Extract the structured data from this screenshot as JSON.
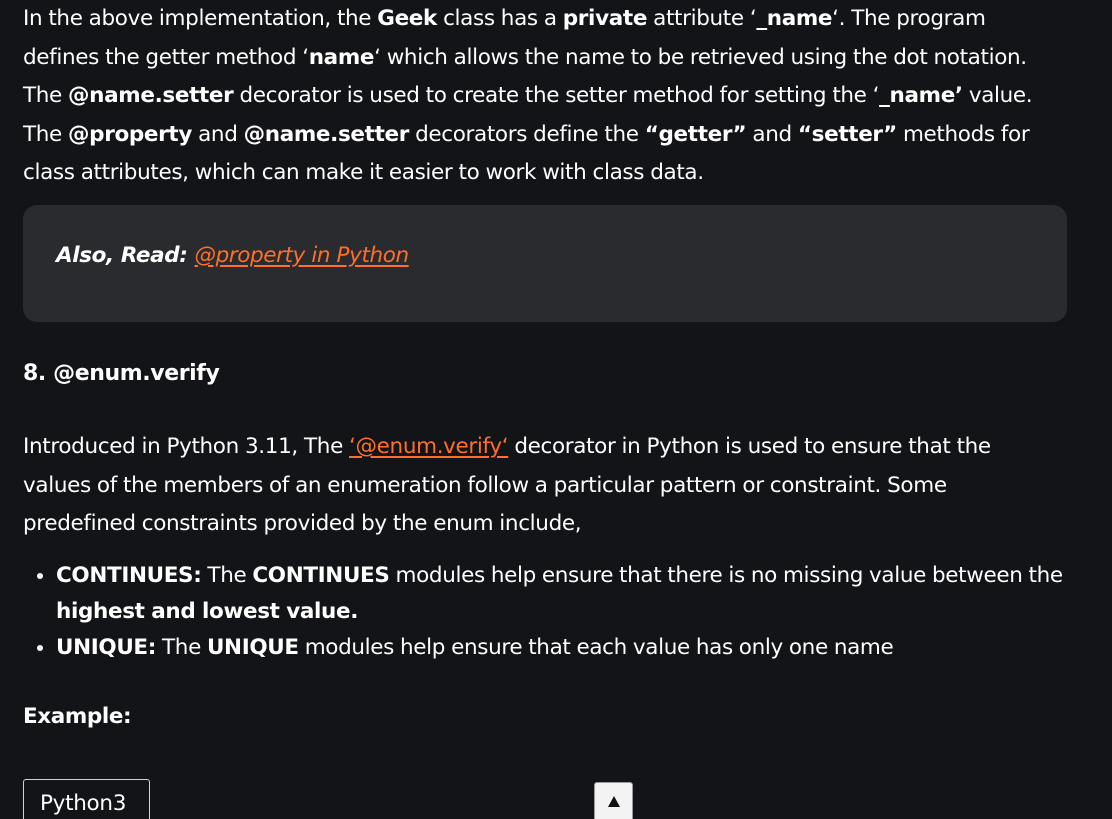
{
  "para1": {
    "t1": "In the above implementation, the ",
    "b1": "Geek",
    "t2": " class has a ",
    "b2": "private",
    "t3": " attribute ‘",
    "b3": "_name",
    "t4": "‘. The program defines the getter method ‘",
    "b4": "name",
    "t5": "‘ which allows the name to be retrieved using the dot notation. The ",
    "b5": "@name.setter",
    "t6": " decorator is used to create the setter method for setting the ‘",
    "b6": "_name’",
    "t7": " value. The ",
    "b7": "@property",
    "t8": " and ",
    "b8": "@name.setter",
    "t9": " decorators define the ",
    "b9": "“getter”",
    "t10": " and ",
    "b10": "“setter”",
    "t11": " methods for class attributes, which can make it easier to work with class data."
  },
  "callout": {
    "prefix": "Also, Read: ",
    "link": "@property in Python"
  },
  "heading": "8. @enum.verify",
  "para2": {
    "t1": "Introduced in Python 3.11, The ",
    "link": "‘@enum.verify‘",
    "t2": " decorator in Python is used to ensure that the values of the members of an enumeration follow a particular pattern or constraint. Some predefined constraints provided by the enum include,"
  },
  "bullets": [
    {
      "label": "CONTINUES:",
      "t1": " The ",
      "b1": "CONTINUES",
      "t2": " modules help ensure that there is no missing value between the ",
      "b2": "highest and lowest value."
    },
    {
      "label": "UNIQUE:",
      "t1": " The ",
      "b1": "UNIQUE",
      "t2": " modules help ensure that each value has only one name"
    }
  ],
  "example_label": "Example:",
  "code_tab": "Python3",
  "colors": {
    "background": "#131417",
    "link": "#ff6f2a",
    "callout_bg": "#2a2b2f"
  },
  "icons": {
    "scroll_up": "triangle-up-icon"
  }
}
